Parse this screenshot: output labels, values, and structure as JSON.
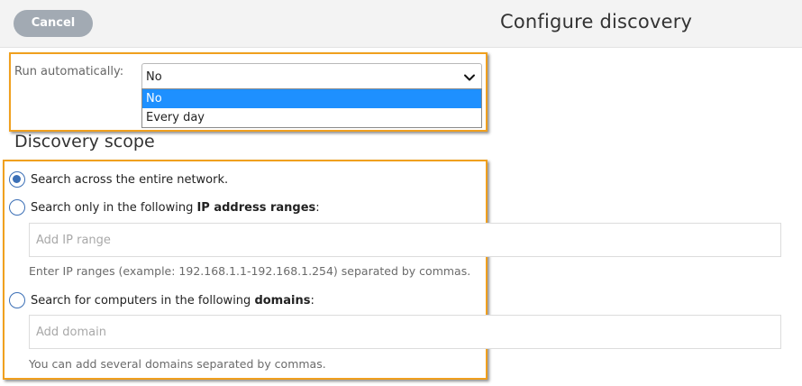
{
  "header": {
    "cancel_label": "Cancel",
    "title": "Configure discovery"
  },
  "run_automatically": {
    "label": "Run automatically:",
    "selected": "No",
    "options": [
      "No",
      "Every day"
    ]
  },
  "scope": {
    "heading": "Discovery scope",
    "options": [
      {
        "text": "Search across the entire network.",
        "checked": true
      },
      {
        "text_before": "Search only in the following ",
        "bold": "IP address ranges",
        "text_after": ":",
        "checked": false
      },
      {
        "text_before": "Search for computers in the following ",
        "bold": "domains",
        "text_after": ":",
        "checked": false
      }
    ],
    "ip_input": {
      "placeholder": "Add IP range",
      "hint": "Enter IP ranges (example: 192.168.1.1-192.168.1.254) separated by commas."
    },
    "domain_input": {
      "placeholder": "Add domain",
      "hint": "You can add several domains separated by commas."
    }
  },
  "colors": {
    "highlight_border": "#f0a01e",
    "selected_option": "#1e90ff",
    "radio": "#3b6fb6",
    "cancel_button": "#a2aab3"
  },
  "icons": [
    "chevron-down-icon",
    "radio-checked-icon",
    "radio-unchecked-icon"
  ]
}
